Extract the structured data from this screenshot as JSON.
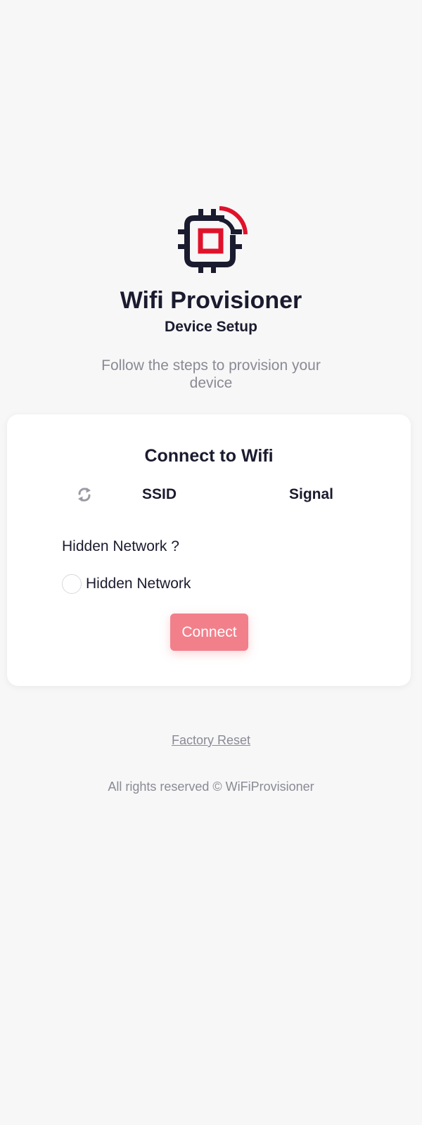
{
  "colors": {
    "background": "#f7f7f8",
    "text_primary": "#1b1b2f",
    "text_muted": "#8a8a94",
    "accent": "#e0122a",
    "button": "#f1808b"
  },
  "header": {
    "logo_icon": "chip-wifi-icon",
    "title": "Wifi Provisioner",
    "subtitle": "Device Setup",
    "description": "Follow the steps to provision your device"
  },
  "card": {
    "title": "Connect to Wifi",
    "refresh_icon": "refresh-icon",
    "columns": {
      "ssid": "SSID",
      "signal": "Signal"
    },
    "hidden_network_label": "Hidden Network ?",
    "hidden_network_option": "Hidden Network",
    "connect_label": "Connect"
  },
  "links": {
    "factory_reset": "Factory Reset"
  },
  "footer": {
    "copyright": "All rights reserved © WiFiProvisioner"
  }
}
